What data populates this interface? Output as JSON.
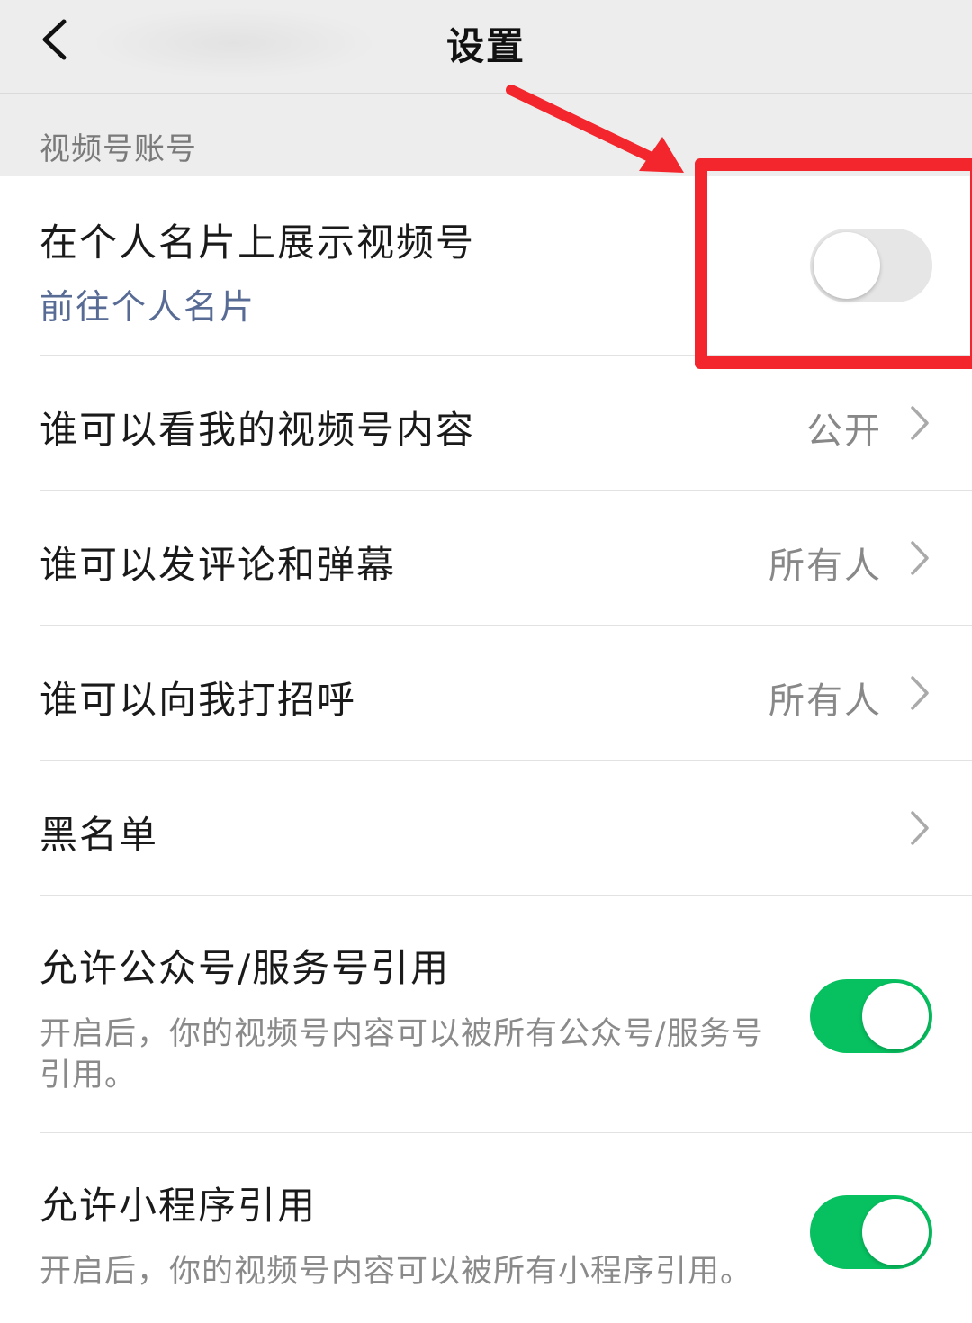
{
  "nav": {
    "title": "设置",
    "back_icon": "chevron-left-icon"
  },
  "section": {
    "label": "视频号账号"
  },
  "rows": {
    "show_on_card": {
      "title": "在个人名片上展示视频号",
      "link": "前往个人名片",
      "switch_on": false
    },
    "who_can_view": {
      "title": "谁可以看我的视频号内容",
      "value": "公开"
    },
    "who_can_comment": {
      "title": "谁可以发评论和弹幕",
      "value": "所有人"
    },
    "who_can_greet": {
      "title": "谁可以向我打招呼",
      "value": "所有人"
    },
    "blacklist": {
      "title": "黑名单"
    },
    "allow_official_accounts": {
      "title": "允许公众号/服务号引用",
      "desc": "开启后，你的视频号内容可以被所有公众号/服务号引用。",
      "switch_on": true
    },
    "allow_mini_programs": {
      "title": "允许小程序引用",
      "desc": "开启后，你的视频号内容可以被所有小程序引用。",
      "switch_on": true
    }
  },
  "colors": {
    "switch_on": "#07c160",
    "switch_off": "#e6e6e6",
    "link": "#576b95",
    "annotation": "#f2262c",
    "nav_bg": "#ededed"
  }
}
